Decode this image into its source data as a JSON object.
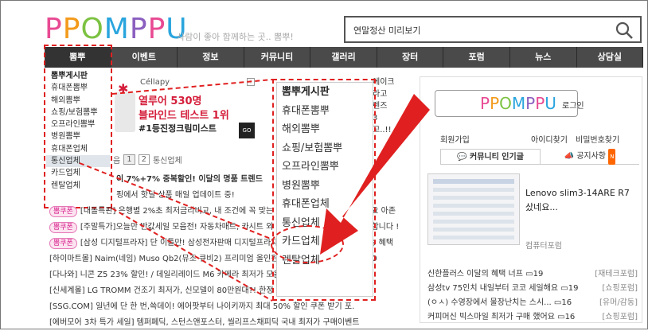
{
  "header": {
    "logo_letters": [
      "P",
      "P",
      "O",
      "M",
      "P",
      "P",
      "U"
    ],
    "slogan": "사람이 좋아 함께하는 곳.. 뽐뿌!",
    "search_query": "연말정산 미리보기"
  },
  "nav": {
    "items": [
      "뽐뿌",
      "이벤트",
      "정보",
      "커뮤니티",
      "갤러리",
      "장터",
      "포럼",
      "뉴스",
      "상담실"
    ]
  },
  "dropdown_small": {
    "header": "뽐뿌게시판",
    "items": [
      "휴대폰뽐뿌",
      "해외뽐뿌",
      "쇼핑/보험뽐뿌",
      "오프라인뽐뿌",
      "병원뽐뿌",
      "휴대폰업체",
      "통신업체",
      "카드업체",
      "렌탈업체"
    ],
    "selected": "통신업체"
  },
  "dropdown_big": {
    "header": "뽐뿌게시판",
    "items": [
      "휴대폰뽐뿌",
      "해외뽐뿌",
      "쇼핑/보험뽐뿌",
      "오프라인뽐뿌",
      "병원뽐뿌",
      "휴대폰업체",
      "통신업체",
      "카드업체",
      "렌탈업체"
    ]
  },
  "ad": {
    "brand": "Céllapy",
    "line1": "열루어 530명",
    "line2": "블라인드 테스트 1위",
    "line3": "#1등진정크림미스트",
    "go": "GO"
  },
  "partial_right": [
    "에이크",
    "라고",
    "렌즈",
    "3",
    "고..!!"
  ],
  "pager": {
    "prefix": "음",
    "pages": [
      "1",
      "2"
    ],
    "tab": "통신업체"
  },
  "list": [
    {
      "badge": "",
      "text": "이 7%+7% 중복할인! 이달의 명품 트렌드",
      "bold": true
    },
    {
      "badge": "",
      "text": "핑에서 핫딜 상품 매일 업데이트 중!",
      "bold": false
    },
    {
      "badge": "뽐쿠폰",
      "text": "[내돌특판] 은행별 2%초 최저금리비교, 내 조건에 꼭 맞는 대출상품 찾기 지금 확인하세요 아존",
      "bold": false
    },
    {
      "badge": "뽐쿠폰",
      "text": "[주말특가]오늘만 반값세일 모음전! 자동차매트, 카시트 외 인기상품 한정수량 특가 판매합니다 !",
      "bold": false
    },
    {
      "badge": "뽐쿠폰",
      "text": "[삼성 디지털프라자] 단 이틀만! 삼성전자판매 디지털프라자 특가 놓치지 마세요 무료배송 혜택",
      "bold": false
    },
    {
      "badge": "",
      "text": "[하이마트몰] Naim(네임) Muso Qb2(뮤조 큐비2) 프리미엄 올인원 블루투스 스피커 특가 590,0",
      "bold": false
    },
    {
      "badge": "",
      "text": "[다나와] 니콘 Z5 23% 할인! / 데일리레이드 M6 카메라 최저가 모음전 실시간 업데이트 ( 5",
      "bold": false
    },
    {
      "badge": "",
      "text": "[신세계몰] LG TROMM 건조기 최저가, 신모델이 80만원대?! 한정 수량 특가전 진행중 최저",
      "bold": false
    },
    {
      "badge": "",
      "text": "[SSG.COM] 일년에 단 한 번,쓱데이! 에어팟부터 나이키까지 최대 50% 할인 쿠폰 받기 포.",
      "bold": false
    },
    {
      "badge": "",
      "text": "[에버모어 3차 특가 세일] 템퍼페딕, 스턴스앤포스터, 씰리프스채피딕 국내 최저가 구매이벤트",
      "bold": false
    }
  ],
  "right_panel": {
    "login_label": "로그인",
    "links": [
      "회원가입",
      "아이디찾기",
      "비밀번호찾기"
    ],
    "tabs": [
      "커뮤니티 인기글",
      "공지사항"
    ],
    "new_badge": "N",
    "popular_title": "Lenovo slim3-14ARE R7 샀네요...",
    "popular_source": "컴퓨터포럼",
    "list": [
      {
        "title": "신한플러스 이달의 혜택 너프",
        "count": "19",
        "cat": "[재테크포럼]"
      },
      {
        "title": "삼성tv 75인치 내일부터 코코 세일해요",
        "count": "19",
        "cat": "[쇼핑포럼]"
      },
      {
        "title": "(ㅇㅅ) 수영장에서 물장난치는 스시...",
        "count": "16",
        "cat": "[유머/감동]"
      },
      {
        "title": "커피머신 빅스마일 최저가 구매 했어요",
        "count": "16",
        "cat": "[쇼핑포럼]"
      }
    ]
  },
  "colors": {
    "annotation_red": "#e02020",
    "nav_bg": "#4a4a4a",
    "badge_pink": "#d8208d"
  }
}
